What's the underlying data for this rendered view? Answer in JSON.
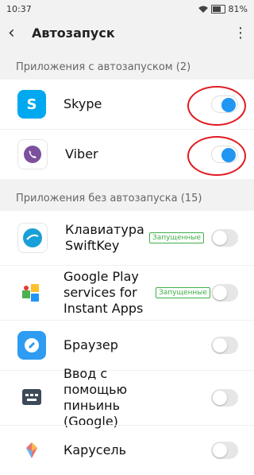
{
  "status": {
    "time": "10:37",
    "battery": "81%"
  },
  "appbar": {
    "title": "Автозапуск"
  },
  "sections": [
    {
      "title": "Приложения с автозапуском (2)",
      "items": [
        {
          "label": "Skype",
          "on": true
        },
        {
          "label": "Viber",
          "on": true
        }
      ]
    },
    {
      "title": "Приложения без автозапуска (15)",
      "items": [
        {
          "label": "Клавиатура SwiftKey",
          "badge": "Запущенные",
          "on": false
        },
        {
          "label": "Google Play services for Instant Apps",
          "badge": "Запущенные",
          "on": false
        },
        {
          "label": "Браузер",
          "on": false
        },
        {
          "label": "Ввод с помощью пиньинь (Google)",
          "on": false
        },
        {
          "label": "Карусель",
          "on": false
        }
      ]
    }
  ],
  "colors": {
    "accent": "#2196f3",
    "highlight": "#e11b22",
    "badge": "#3fae49"
  }
}
